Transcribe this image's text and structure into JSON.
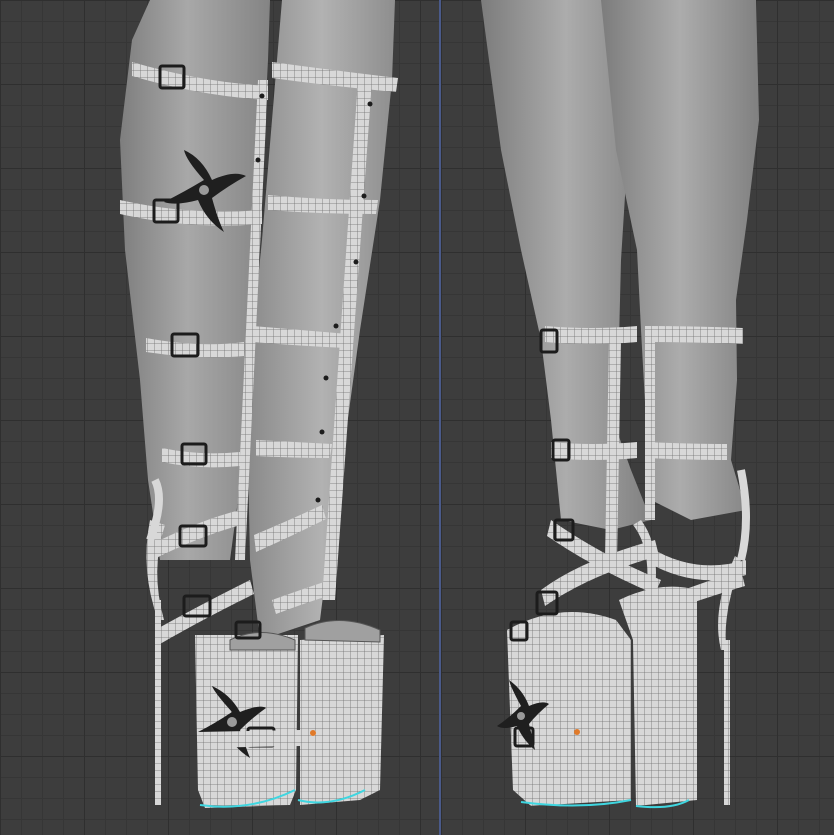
{
  "viewports": [
    {
      "id": "left",
      "view": "back-three-quarter",
      "model": "legs-with-strappy-platform-heels"
    },
    {
      "id": "right",
      "view": "back-side",
      "model": "legs-with-strappy-platform-heels"
    }
  ],
  "colors": {
    "background": "#3d3d3d",
    "grid_major": "#2f2f2f",
    "grid_minor": "#363636",
    "divider": "#4a5a8a",
    "skin": "#9a9a9a",
    "strap": "#d6d6d6",
    "wire": "#7a7a7a",
    "shuriken": "#1f1f1f",
    "selection_edge": "#3fd6e0",
    "origin_point": "#e07a2a"
  },
  "icons": [
    "shuriken-icon",
    "buckle-icon",
    "origin-point-icon"
  ]
}
